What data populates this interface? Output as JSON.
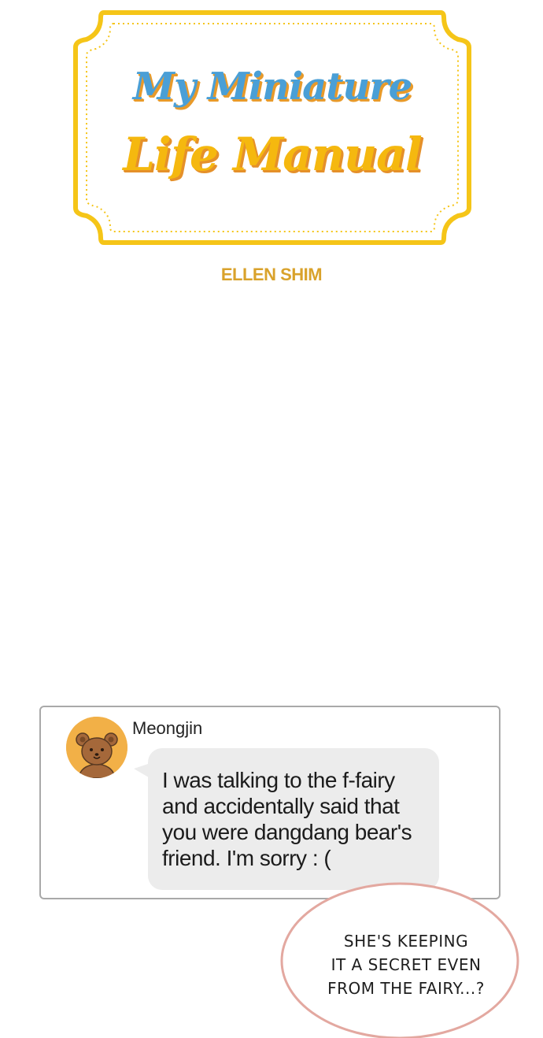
{
  "title": {
    "line1": "My Miniature",
    "line2": "Life Manual"
  },
  "author": "ELLEN SHIM",
  "message": {
    "sender": "Meongjin",
    "avatar_icon": "bear-face-icon",
    "text": "I was talking to the f-fairy\nand accidentally said that\nyou were dangdang bear's\nfriend. I'm sorry : ("
  },
  "speech": {
    "text": "SHE'S KEEPING\nIT A SECRET EVEN\nFROM THE FAIRY...?"
  },
  "colors": {
    "frame_gold": "#f5c518",
    "title_blue": "#4a9fd6",
    "title_gold": "#f5b80f",
    "author_gold": "#d9a22b",
    "avatar_orange": "#f2b047",
    "balloon_outline": "#e3a8a0"
  }
}
